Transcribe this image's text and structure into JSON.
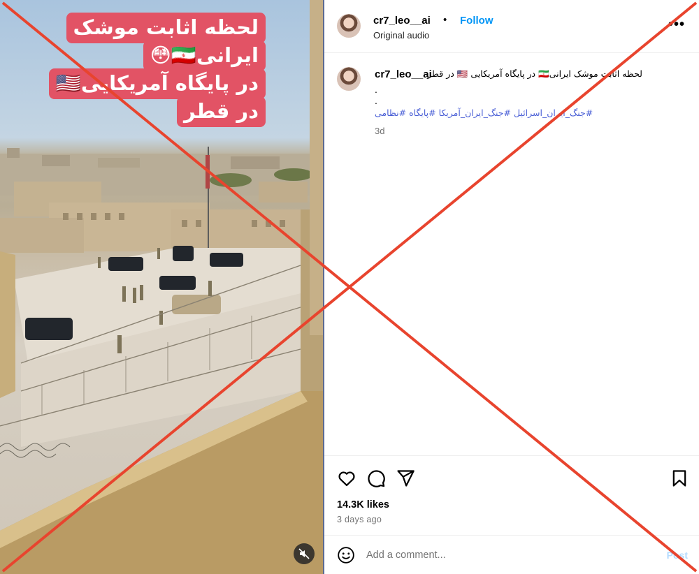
{
  "video": {
    "caption_lines": [
      "لحظه اثابت موشک",
      "ایرانی🇮🇷😳",
      "در پایگاه آمریکایی🇺🇸",
      "در قطر"
    ],
    "mute_icon": "speaker-muted-icon"
  },
  "post": {
    "username": "cr7_leo__ai",
    "separator": "•",
    "follow_label": "Follow",
    "audio": "Original audio",
    "more_label": "•••",
    "caption": {
      "username": "cr7_leo__ai",
      "text": "لحظه اثابت موشک ایرانی🇮🇷 در پایگاه آمریکایی 🇺🇸 در قطر",
      "dots": [
        ".",
        " ."
      ],
      "hashtags": "#جنگ_ایران_اسرائیل #جنگ_ایران_آمریکا #پایگاه #نظامی",
      "age": "3d"
    },
    "likes": "14.3K likes",
    "posted": "3 days ago",
    "comment_placeholder": "Add a comment...",
    "post_label": "Post"
  },
  "icons": {
    "like": "heart-icon",
    "comment": "comment-icon",
    "share": "send-icon",
    "save": "bookmark-icon",
    "emoji": "emoji-icon"
  },
  "colors": {
    "follow": "#0095f6",
    "overlay_x": "#e8442e",
    "caption_bg": "#e25365",
    "hashtag": "#4a5fd6"
  }
}
